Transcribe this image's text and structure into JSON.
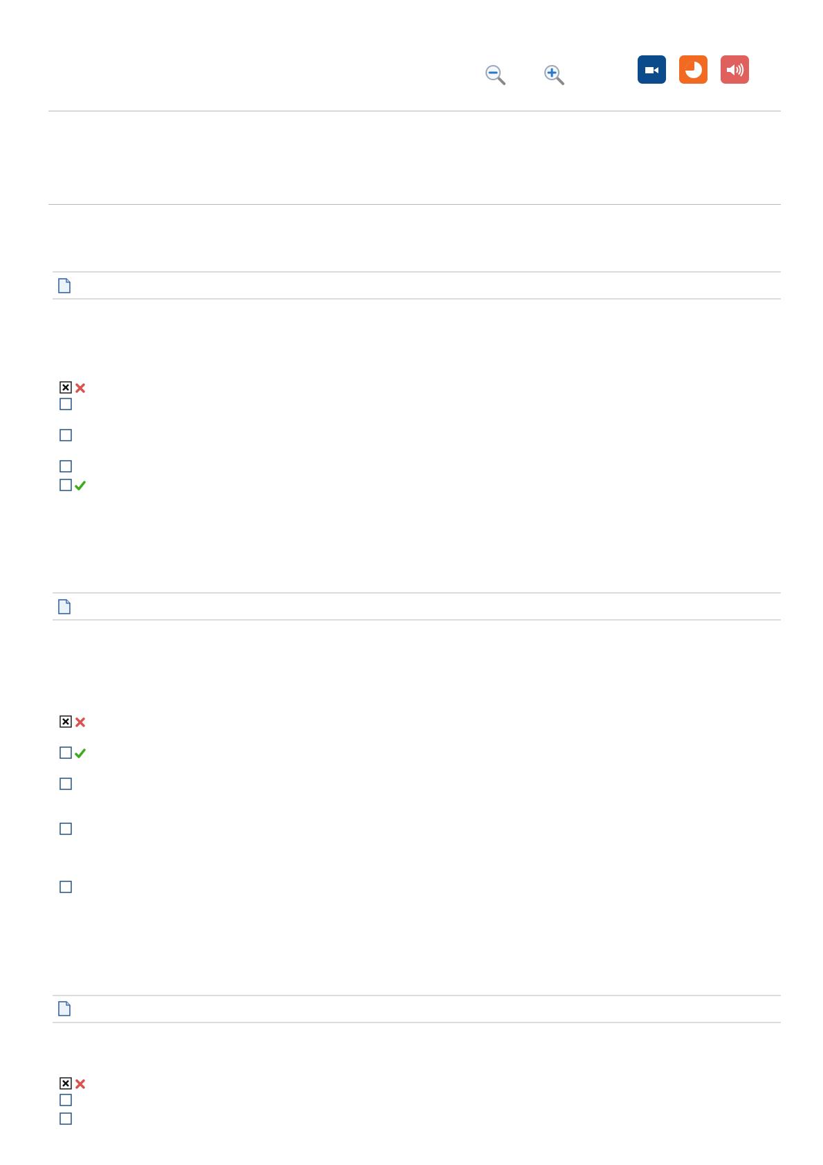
{
  "toolbar": {
    "zoom_out_icon": "zoom-out-icon",
    "zoom_in_icon": "zoom-in-icon",
    "video_icon": "video-camera-icon",
    "chart_icon": "pie-chart-icon",
    "audio_icon": "speaker-icon",
    "colors": {
      "video": "#0b4a8b",
      "chart": "#f26a21",
      "audio": "#e0605e"
    }
  },
  "sections": [
    {
      "icon": "document-icon",
      "options": [
        {
          "checked": true,
          "mark": "incorrect"
        },
        {
          "checked": false,
          "mark": "none"
        },
        {
          "checked": false,
          "mark": "none"
        },
        {
          "checked": false,
          "mark": "none"
        },
        {
          "checked": false,
          "mark": "correct"
        }
      ]
    },
    {
      "icon": "document-icon",
      "options": [
        {
          "checked": true,
          "mark": "incorrect"
        },
        {
          "checked": false,
          "mark": "correct"
        },
        {
          "checked": false,
          "mark": "none"
        },
        {
          "checked": false,
          "mark": "none"
        },
        {
          "checked": false,
          "mark": "none"
        }
      ]
    },
    {
      "icon": "document-icon",
      "options": [
        {
          "checked": true,
          "mark": "incorrect"
        },
        {
          "checked": false,
          "mark": "none"
        },
        {
          "checked": false,
          "mark": "none"
        }
      ]
    }
  ]
}
